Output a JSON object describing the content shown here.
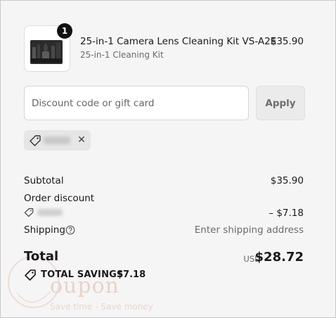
{
  "cart": {
    "quantity_badge": "1",
    "item": {
      "name": "25-in-1 Camera Lens Cleaning Kit VS-A2E",
      "variant": "25-in-1 Cleaning Kit",
      "price": "$35.90"
    }
  },
  "discount": {
    "placeholder": "Discount code or gift card",
    "value": "",
    "apply_label": "Apply",
    "remove_symbol": "✕"
  },
  "summary": {
    "subtotal_label": "Subtotal",
    "subtotal_value": "$35.90",
    "order_discount_label": "Order discount",
    "order_discount_value": "– $7.18",
    "shipping_label": "Shipping",
    "shipping_value": "Enter shipping address",
    "total_label": "Total",
    "currency": "USD",
    "total_value": "$28.72",
    "savings_label": "TOTAL SAVINGS",
    "savings_value": "$7.18"
  },
  "watermark": {
    "word": "oupon",
    "tagline": "Save time - Save money"
  },
  "icons": {
    "tag": "tag-icon",
    "close": "close-icon",
    "help": "question-circle-icon",
    "savings": "tag-icon"
  },
  "colors": {
    "background": "#f5f5f5",
    "badge": "#111111",
    "watermark": "#e8d3c6"
  }
}
